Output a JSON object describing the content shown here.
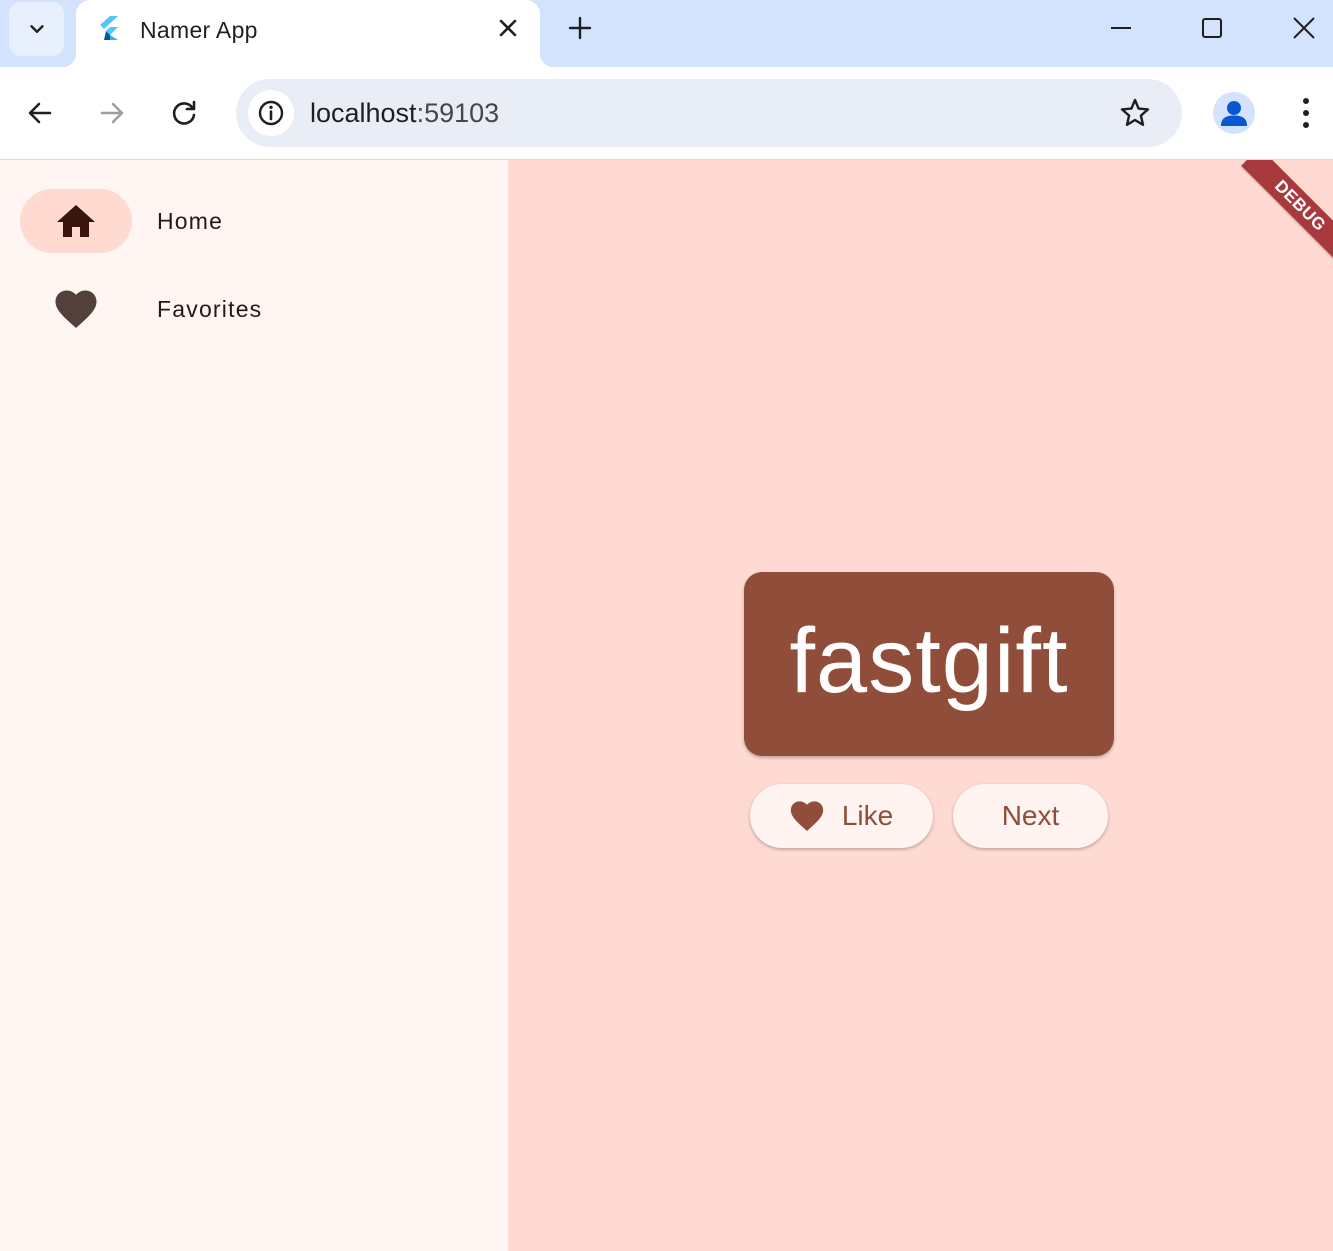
{
  "browser": {
    "tab": {
      "title": "Namer App",
      "favicon": "flutter-logo-icon"
    },
    "toolbar": {
      "url_host": "localhost",
      "url_port": ":59103"
    }
  },
  "app": {
    "rail": {
      "items": [
        {
          "label": "Home",
          "icon": "home-icon",
          "selected": true
        },
        {
          "label": "Favorites",
          "icon": "heart-icon",
          "selected": false
        }
      ]
    },
    "main": {
      "debug_banner": "DEBUG",
      "word": "fastgift",
      "like_label": "Like",
      "next_label": "Next"
    }
  },
  "colors": {
    "tabstrip": "#d3e3fd",
    "rail_background": "#fff5f2",
    "rail_indicator": "#ffdad1",
    "main_background": "#ffdad3",
    "card": "#904d3a",
    "button_background": "#fff4f1",
    "button_text": "#904d3a",
    "debug_banner": "#a83a3e"
  }
}
